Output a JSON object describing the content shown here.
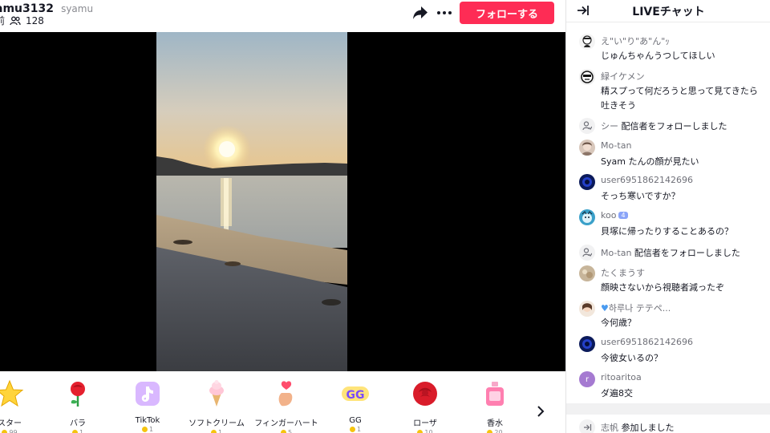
{
  "header": {
    "username": "amu3132",
    "handle": "syamu",
    "viewer_prefix": "前",
    "viewer_count": "128",
    "follow_label": "フォローする"
  },
  "gifts": {
    "items": [
      {
        "name": "スター",
        "cost": "99"
      },
      {
        "name": "バラ",
        "cost": "1"
      },
      {
        "name": "TikTok",
        "cost": "1"
      },
      {
        "name": "ソフトクリーム",
        "cost": "1"
      },
      {
        "name": "フィンガーハート",
        "cost": "5"
      },
      {
        "name": "GG",
        "cost": "1"
      },
      {
        "name": "ローザ",
        "cost": "10"
      },
      {
        "name": "香水",
        "cost": "20"
      }
    ]
  },
  "chat": {
    "title": "LIVEチャット",
    "messages": [
      {
        "name": "え\"い\"り\"あ\"ん\"ｯ",
        "text": "じゅんちゃんうつしてほしい"
      },
      {
        "name": "緑イケメン",
        "text": "精スプって何だろうと思って見てきたら吐きそう"
      },
      {
        "name": "シー",
        "action": "配信者をフォローしました"
      },
      {
        "name": "Mo-tan",
        "text": "Syam たんの顔が見たい"
      },
      {
        "name": "user6951862142696",
        "text": "そっち寒いですか？"
      },
      {
        "name": "koo",
        "badge": "4",
        "text": "貝塚に帰ったりすることあるの？"
      },
      {
        "name": "Mo-tan",
        "action": "配信者をフォローしました"
      },
      {
        "name": "たくまうす",
        "text": "顔映さないから視聴者減ったぞ"
      },
      {
        "name": "하루나 テテペ...",
        "text": "今何歳？"
      },
      {
        "name": "user6951862142696",
        "text": "今彼女いるの？"
      },
      {
        "name": "ritoaritoa",
        "avatar_letter": "r",
        "text": "ダ遍8交"
      },
      {
        "name": "志帆",
        "action": "参加しました"
      }
    ]
  },
  "colors": {
    "accent": "#fe2c55",
    "chat_name": "#6f7078",
    "coin": "#f5c40f"
  }
}
